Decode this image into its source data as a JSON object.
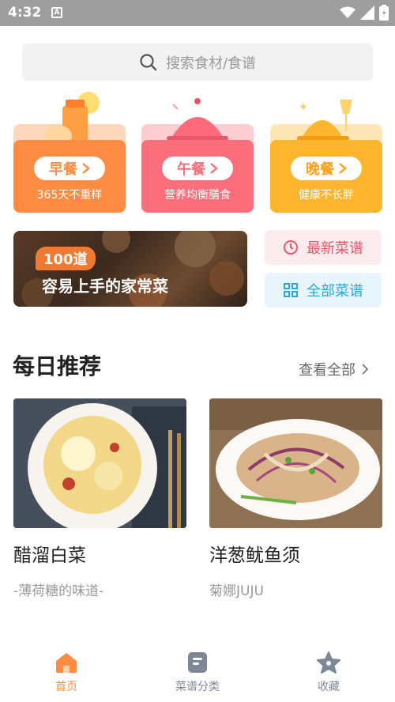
{
  "status": {
    "time": "4:32",
    "notif_letter": "A"
  },
  "search": {
    "placeholder": "搜索食材/食谱"
  },
  "meals": [
    {
      "label": "早餐",
      "subtitle": "365天不重样",
      "color": "#ff8c42"
    },
    {
      "label": "午餐",
      "subtitle": "营养均衡膳食",
      "color": "#fa6f7b"
    },
    {
      "label": "晚餐",
      "subtitle": "健康不长胖",
      "color": "#ffb62e"
    }
  ],
  "banner": {
    "badge": "100道",
    "title": "容易上手的家常菜"
  },
  "quick_links": {
    "latest": "最新菜谱",
    "all": "全部菜谱"
  },
  "daily": {
    "title": "每日推荐",
    "see_all": "查看全部",
    "items": [
      {
        "name": "醋溜白菜",
        "author": "-薄荷糖的味道-"
      },
      {
        "name": "洋葱鱿鱼须",
        "author": "菊娜JUJU"
      }
    ]
  },
  "tabs": [
    {
      "label": "首页",
      "active": true
    },
    {
      "label": "菜谱分类",
      "active": false
    },
    {
      "label": "收藏",
      "active": false
    }
  ],
  "colors": {
    "accent": "#ff8c42",
    "inactive_tab": "#7d8897"
  }
}
